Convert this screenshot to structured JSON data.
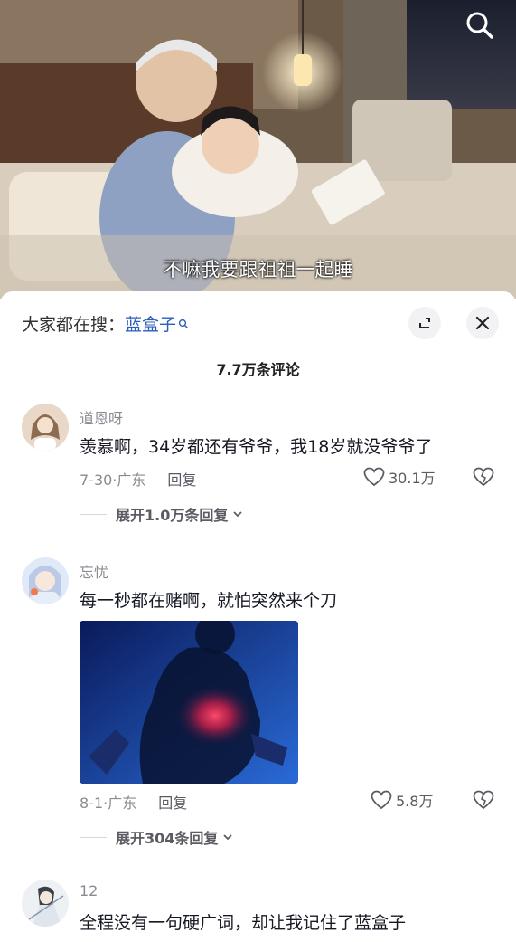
{
  "video": {
    "subtitle": "不嘛我要跟祖祖一起睡",
    "search_icon": "search-icon"
  },
  "sheet": {
    "search_prefix": "大家都在搜：",
    "search_keyword": "蓝盒子",
    "comment_count": "7.7万条评论"
  },
  "comments": [
    {
      "user": "道恩呀",
      "text": "羡慕啊，34岁都还有爷爷，我18岁就没爷爷了",
      "date": "7-30·广东",
      "reply": "回复",
      "likes": "30.1万",
      "expand": "展开1.0万条回复"
    },
    {
      "user": "忘忧",
      "text": "每一秒都在赌啊，就怕突然来个刀",
      "date": "8-1·广东",
      "reply": "回复",
      "likes": "5.8万",
      "expand": "展开304条回复"
    },
    {
      "user": "12",
      "text": "全程没有一句硬广词，却让我记住了蓝盒子"
    }
  ],
  "colors": {
    "keyword": "#2b5db9",
    "muted": "#8a8b91"
  }
}
